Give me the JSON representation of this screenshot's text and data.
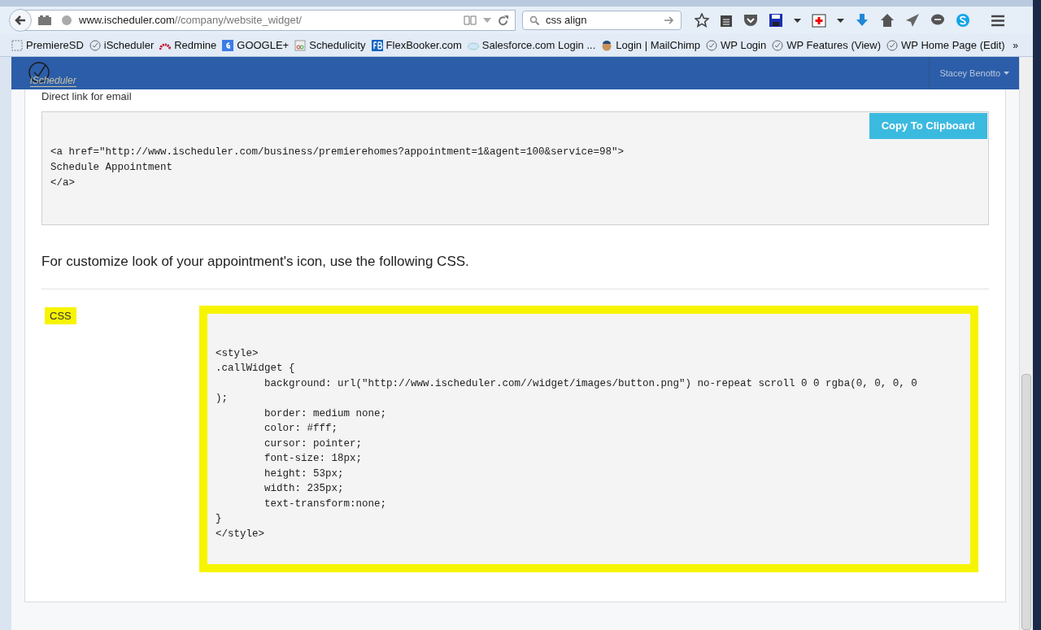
{
  "browser": {
    "url_domain": "www.ischeduler.com",
    "url_path": "//company/website_widget/",
    "search": "css align",
    "bookmarks": [
      {
        "label": "PremiereSD",
        "kind": "folder"
      },
      {
        "label": "iScheduler",
        "kind": "clock"
      },
      {
        "label": "Redmine",
        "kind": "redmine"
      },
      {
        "label": "GOOGLE+",
        "kind": "google"
      },
      {
        "label": "Schedulicity",
        "kind": "sched"
      },
      {
        "label": "FlexBooker.com",
        "kind": "fb"
      },
      {
        "label": "Salesforce.com Login ...",
        "kind": "cloud"
      },
      {
        "label": "Login | MailChimp",
        "kind": "chimp"
      },
      {
        "label": "WP Login",
        "kind": "clock"
      },
      {
        "label": "WP Features (View)",
        "kind": "clock"
      },
      {
        "label": "WP Home Page (Edit)",
        "kind": "clock"
      }
    ],
    "overflow": "»"
  },
  "app": {
    "logo": "iScheduler",
    "user": "Stacey Benotto"
  },
  "email_link": {
    "label": "Direct link for email",
    "button": "Copy To Clipboard",
    "code": [
      "<a href=\"http://www.ischeduler.com/business/premierehomes?appointment=1&agent=100&service=98\">",
      "Schedule Appointment",
      "</a>"
    ]
  },
  "css_section": {
    "heading": "For customize look of your appointment's icon, use the following CSS.",
    "label": "CSS",
    "highlighted": true,
    "code": [
      "<style>",
      ".callWidget {",
      "        background: url(\"http://www.ischeduler.com//widget/images/button.png\") no-repeat scroll 0 0 rgba(0, 0, 0, 0",
      ");",
      "        border: medium none;",
      "        color: #fff;",
      "        cursor: pointer;",
      "        font-size: 18px;",
      "        height: 53px;",
      "        width: 235px;",
      "        text-transform:none;",
      "}",
      "</style>"
    ]
  }
}
